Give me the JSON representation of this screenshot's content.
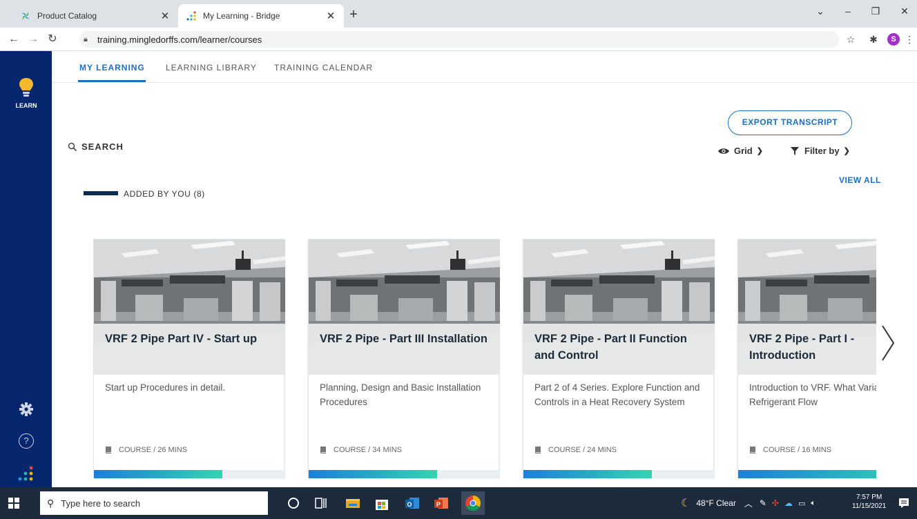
{
  "browser": {
    "tabs": [
      {
        "title": "Product Catalog",
        "active": false
      },
      {
        "title": "My Learning - Bridge",
        "active": true
      }
    ],
    "url": "training.mingledorffs.com/learner/courses",
    "profile_initial": "S"
  },
  "sidebar": {
    "learn_label": "LEARN",
    "colors": {
      "background": "#06276e",
      "bulb": "#f5b82e"
    }
  },
  "nav": {
    "tabs": [
      {
        "label": "MY LEARNING",
        "active": true
      },
      {
        "label": "LEARNING LIBRARY",
        "active": false
      },
      {
        "label": "TRAINING CALENDAR",
        "active": false
      }
    ]
  },
  "toolbar": {
    "search_label": "SEARCH",
    "export_label": "EXPORT TRANSCRIPT",
    "view_label": "Grid",
    "filter_label": "Filter by"
  },
  "section": {
    "title": "ADDED BY YOU (8)",
    "view_all": "VIEW ALL"
  },
  "courses": [
    {
      "title": "VRF 2 Pipe Part IV - Start up",
      "description": "Start up Procedures in detail.",
      "meta": "COURSE / 26 MINS",
      "progress": 0.67
    },
    {
      "title": "VRF 2 Pipe - Part III Installation",
      "description": "Planning, Design and Basic Installation Procedures",
      "meta": "COURSE / 34 MINS",
      "progress": 0.67
    },
    {
      "title": "VRF 2 Pipe - Part II Function and Control",
      "description": "Part 2 of 4 Series. Explore Function and Controls in a Heat Recovery System",
      "meta": "COURSE / 24 MINS",
      "progress": 0.67
    },
    {
      "title": "VRF 2 Pipe - Part I - Introduction",
      "description": "Introduction to VRF. What Variable Refrigerant Flow",
      "meta": "COURSE / 16 MINS",
      "progress": 0.95
    }
  ],
  "taskbar": {
    "search_placeholder": "Type here to search",
    "weather": "48°F  Clear",
    "time": "7:57 PM",
    "date": "11/15/2021"
  },
  "colors": {
    "accent": "#1a6fc4",
    "progress_start": "#1f7ed6",
    "progress_end": "#36d3b2"
  }
}
